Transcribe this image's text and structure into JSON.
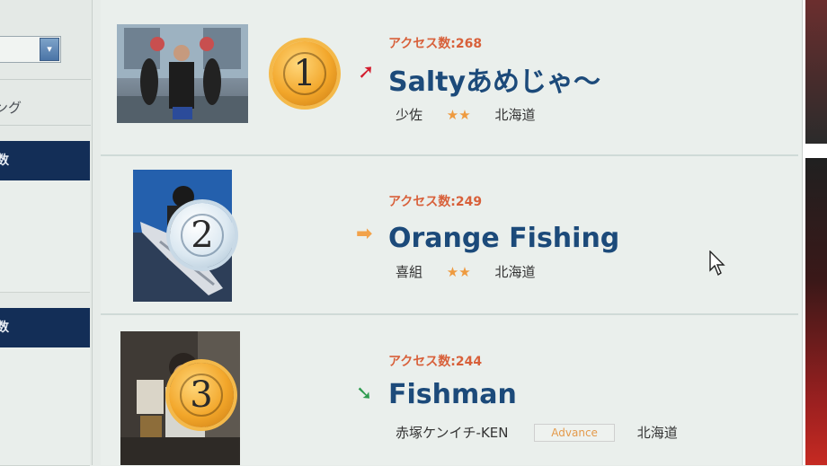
{
  "sidebar": {
    "select_arrow": "▾",
    "link_label": "ング",
    "heading_a": "数",
    "heading_b": "数"
  },
  "ranking": [
    {
      "rank": "1",
      "medal": "gold",
      "trend": "up",
      "trend_glyph": "➚",
      "access": "アクセス数:268",
      "name": "Saltyあめじゃ〜",
      "rank_title": "少佐",
      "stars": "★★",
      "region": "北海道",
      "badge": ""
    },
    {
      "rank": "2",
      "medal": "silver",
      "trend": "flat",
      "trend_glyph": "➡",
      "access": "アクセス数:249",
      "name": "Orange Fishing",
      "rank_title": "喜組",
      "stars": "★★",
      "region": "北海道",
      "badge": ""
    },
    {
      "rank": "3",
      "medal": "gold",
      "trend": "down",
      "trend_glyph": "➘",
      "access": "アクセス数:244",
      "name": "Fishman",
      "rank_title": "赤塚ケンイチ-KEN",
      "stars": "",
      "region": "北海道",
      "badge": "Advance"
    }
  ],
  "colors": {
    "access_text": "#d8603a",
    "name_text": "#1c4a7a",
    "trend_up": "#d31c2d",
    "trend_flat": "#f2a24a",
    "trend_down": "#2d9b4e",
    "sidebar_head": "#132e57"
  }
}
